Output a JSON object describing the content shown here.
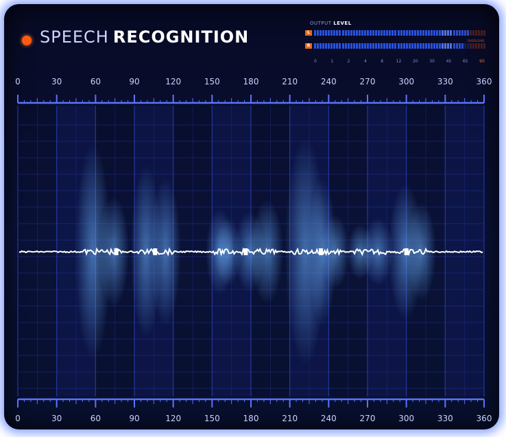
{
  "title": {
    "light": "SPEECH",
    "bold": "RECOGNITION"
  },
  "output_meter": {
    "caption_light": "OUTPUT",
    "caption_bold": "LEVEL",
    "channels": [
      {
        "label": "L",
        "level": 0.9
      },
      {
        "label": "R",
        "level": 0.87
      }
    ],
    "overload_label": "OVERLOAD",
    "scale": [
      "0",
      "1",
      "2",
      "4",
      "8",
      "12",
      "20",
      "30",
      "45",
      "65",
      "90"
    ]
  },
  "axis": {
    "ticks": [
      "0",
      "30",
      "60",
      "90",
      "120",
      "150",
      "180",
      "210",
      "240",
      "270",
      "300",
      "330",
      "360"
    ],
    "min": 0,
    "max": 360
  },
  "colors": {
    "accent": "#ff5a12",
    "wave": "#58a8ff",
    "wave_core": "#ffffff",
    "grid": "#2a3aa8"
  }
}
